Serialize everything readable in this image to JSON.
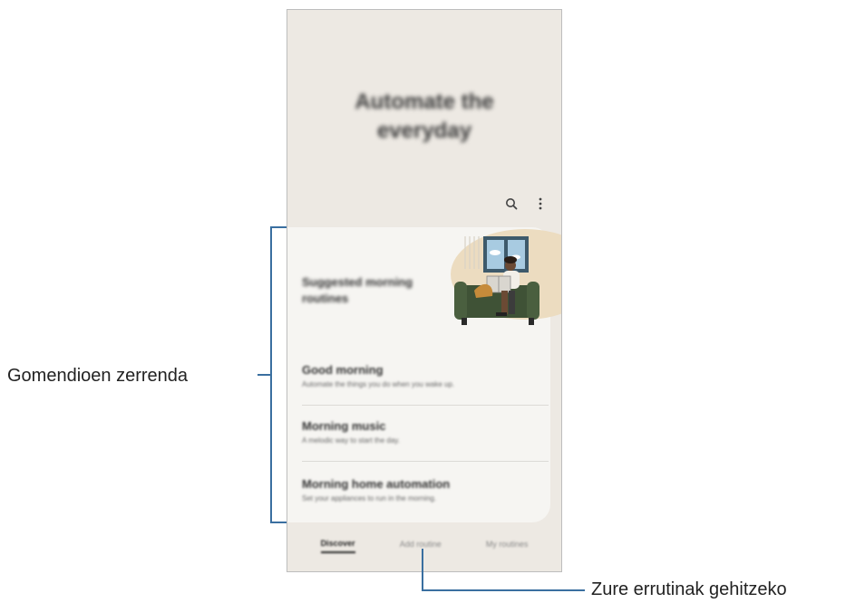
{
  "screen": {
    "hero_title_line1": "Automate the",
    "hero_title_line2": "everyday",
    "toolbar": {
      "search_icon": "search-icon",
      "more_icon": "more-vertical-icon"
    },
    "suggestions_card": {
      "heading": "Suggested morning routines",
      "items": [
        {
          "title": "Good morning",
          "description": "Automate the things you do when you wake up."
        },
        {
          "title": "Morning music",
          "description": "A melodic way to start the day."
        },
        {
          "title": "Morning home automation",
          "description": "Set your appliances to run in the morning."
        }
      ]
    },
    "tabs": [
      {
        "label": "Discover",
        "active": true
      },
      {
        "label": "Add routine",
        "active": false
      },
      {
        "label": "My routines",
        "active": false
      }
    ]
  },
  "callouts": {
    "suggestion_list": "Gomendioen zerrenda",
    "add_routines": "Zure errutinak gehitzeko"
  },
  "colors": {
    "callout_line": "#3a6fa0",
    "screen_background": "#ede9e3",
    "card_background": "#f6f5f2"
  }
}
